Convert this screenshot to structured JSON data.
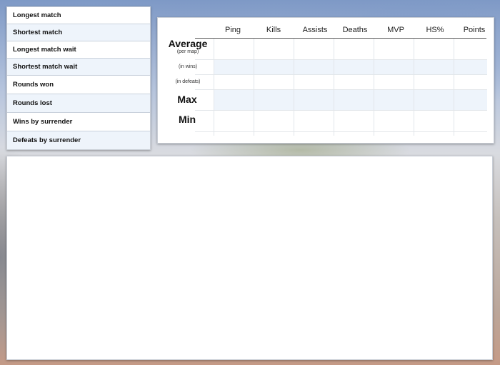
{
  "stats_list": [
    {
      "label": "Longest match"
    },
    {
      "label": "Shortest match"
    },
    {
      "label": "Longest match wait"
    },
    {
      "label": "Shortest match wait"
    },
    {
      "label": "Rounds won"
    },
    {
      "label": "Rounds lost"
    },
    {
      "label": "Wins by surrender"
    },
    {
      "label": "Defeats by surrender"
    }
  ],
  "table": {
    "columns": [
      "Ping",
      "Kills",
      "Assists",
      "Deaths",
      "MVP",
      "HS%",
      "Points"
    ],
    "rows": {
      "average": "Average",
      "per_map": "(per map)",
      "in_wins": "(in wins)",
      "in_defeats": "(in defeats)",
      "max": "Max",
      "min": "Min"
    }
  },
  "colors": {
    "row_alt": "#eef4fb",
    "grid_line": "#e2e6ea",
    "header_rule": "#555555"
  }
}
